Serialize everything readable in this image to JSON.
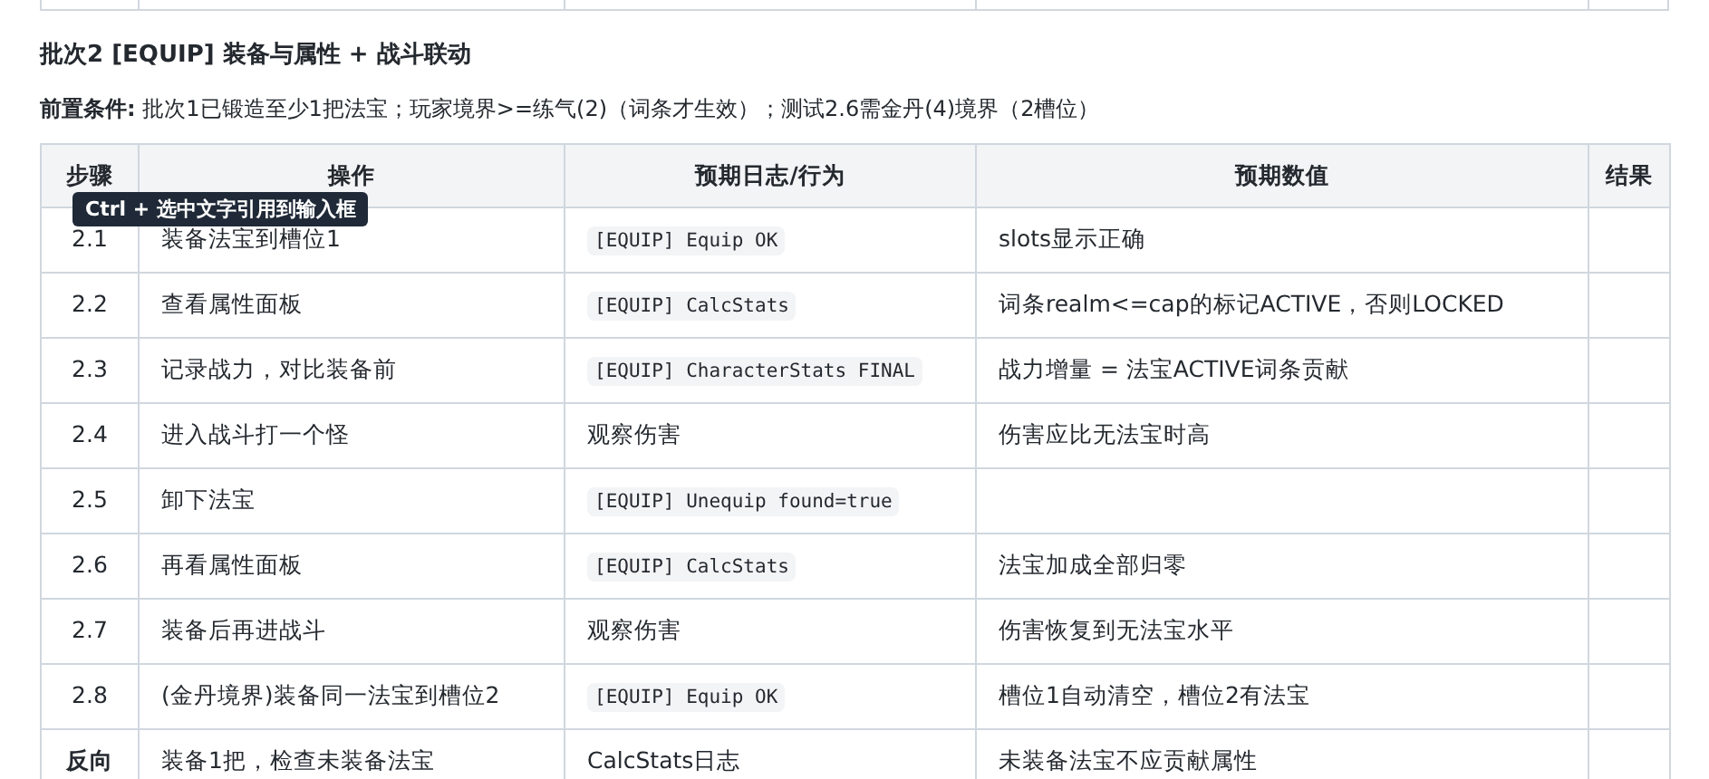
{
  "heading": "批次2 [EQUIP] 装备与属性 + 战斗联动",
  "precondition": "**前置条件:** 批次1已锻造至少1把法宝；玩家境界>=练气(2)（词条才生效）；测试2.6需金丹(4)境界（2槽位）",
  "tooltip": {
    "text": "Ctrl + 选中文字引用到输入框"
  },
  "table": {
    "columns": [
      "步骤",
      "操作",
      "预期日志/行为",
      "预期数值",
      "结果"
    ],
    "rows": [
      {
        "kind": "step",
        "step": "2.1",
        "action": "装备法宝到槽位1",
        "log": {
          "kind": "code",
          "text": "[EQUIP] Equip OK"
        },
        "value": "slots显示正确"
      },
      {
        "kind": "step",
        "step": "2.2",
        "action": "查看属性面板",
        "log": {
          "kind": "code",
          "text": "[EQUIP] CalcStats"
        },
        "value": "词条realm<=cap的标记ACTIVE，否则LOCKED"
      },
      {
        "kind": "step",
        "step": "2.3",
        "action": "记录战力，对比装备前",
        "log": {
          "kind": "code",
          "text": "[EQUIP] CharacterStats FINAL"
        },
        "value": "战力增量 = 法宝ACTIVE词条贡献"
      },
      {
        "kind": "step",
        "step": "2.4",
        "action": "进入战斗打一个怪",
        "log": {
          "kind": "text",
          "text": "观察伤害"
        },
        "value": "伤害应比无法宝时高"
      },
      {
        "kind": "step",
        "step": "2.5",
        "action": "卸下法宝",
        "log": {
          "kind": "code",
          "text": "[EQUIP] Unequip found=true"
        }
      },
      {
        "kind": "step",
        "step": "2.6",
        "action": "再看属性面板",
        "log": {
          "kind": "code",
          "text": "[EQUIP] CalcStats"
        },
        "value": "法宝加成全部归零"
      },
      {
        "kind": "step",
        "step": "2.7",
        "action": "装备后再进战斗",
        "log": {
          "kind": "text",
          "text": "观察伤害"
        },
        "value": "伤害恢复到无法宝水平"
      },
      {
        "kind": "step",
        "step": "2.8",
        "action": "(金丹境界)装备同一法宝到槽位2",
        "log": {
          "kind": "code",
          "text": "[EQUIP] Equip OK"
        },
        "value": "槽位1自动清空，槽位2有法宝"
      },
      {
        "kind": "reverse",
        "step": "反向",
        "action": "装备1把，检查未装备法宝",
        "log": {
          "kind": "text",
          "text": "CalcStats日志"
        },
        "value": "未装备法宝不应贡献属性"
      }
    ]
  }
}
